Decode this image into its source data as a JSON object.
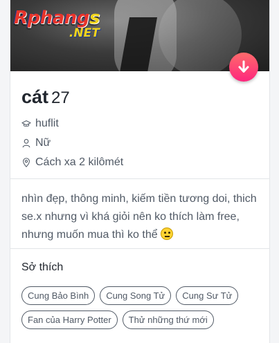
{
  "watermark": {
    "main": "Rphang",
    "suffix": "s",
    "sub": ".NET"
  },
  "profile": {
    "name": "cát",
    "age": "27",
    "school": "huflit",
    "gender": "Nữ",
    "distance": "Cách xa 2 kilômét"
  },
  "bio": "nhìn đẹp, thông minh, kiếm tiền tương doi, thich se.x nhưng vì khá giỏi nên ko thích làm free, nhưng muốn mua thì ko thể",
  "interests": {
    "title": "Sở thích",
    "tags": [
      "Cung Bảo Bình",
      "Cung Song Tử",
      "Cung Sư Tử",
      "Fan của Harry Potter",
      "Thử những thứ mới"
    ]
  },
  "icons": {
    "school": "graduation-cap-icon",
    "gender": "person-icon",
    "distance": "location-pin-icon",
    "collapse": "arrow-down-icon",
    "emoji": "neutral-face-emoji"
  },
  "colors": {
    "accent": "#fd267d",
    "accent_light": "#ff6b6b",
    "text": "#505965",
    "heading": "#21262e"
  }
}
